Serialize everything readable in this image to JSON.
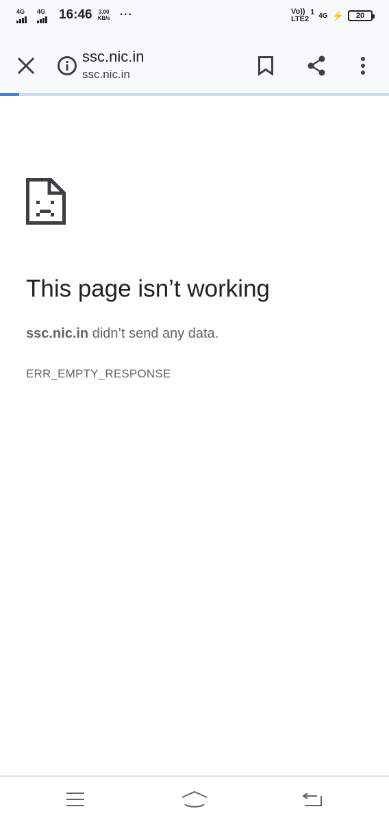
{
  "status_bar": {
    "sim1_network": "4G",
    "sim2_network": "4G",
    "time": "16:46",
    "speed_value": "3.00",
    "speed_unit": "KB/s",
    "more": "···",
    "volte_line1": "Vo))",
    "volte_line2": "LTE2",
    "sim_slot": "1",
    "network_right": "4G",
    "battery": "20"
  },
  "toolbar": {
    "title": "ssc.nic.in",
    "url": "ssc.nic.in",
    "progress": 0.05
  },
  "error": {
    "title": "This page isn’t working",
    "host": "ssc.nic.in",
    "message": " didn’t send any data.",
    "code": "ERR_EMPTY_RESPONSE"
  },
  "colors": {
    "toolbar_bg": "#f8f9fa",
    "progress": "#4a80d8",
    "text_primary": "#202124",
    "text_secondary": "#5f6368"
  }
}
